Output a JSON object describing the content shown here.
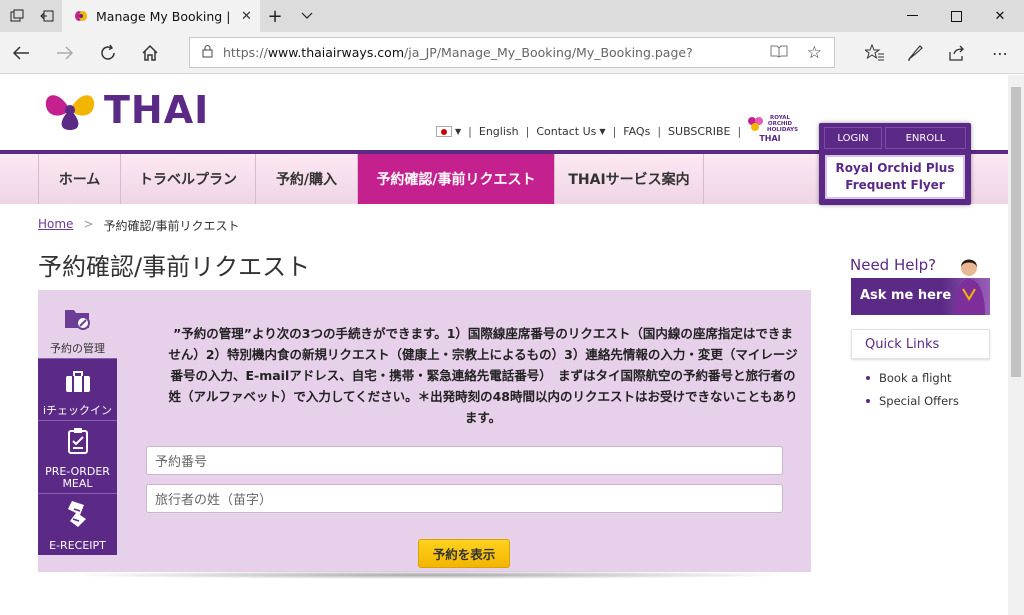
{
  "browser": {
    "tab_title": "Manage My Booking | C",
    "url_scheme": "https://",
    "url_host": "www.thaiairways.com",
    "url_path": "/ja_JP/Manage_My_Booking/My_Booking.page?"
  },
  "header": {
    "logo_text": "THAI",
    "links": [
      "English",
      "Contact Us",
      "FAQs",
      "SUBSCRIBE"
    ],
    "roh_text": "ROYAL ORCHID HOLIDAYS",
    "roh_sub": "THAI"
  },
  "nav": {
    "items": [
      "ホーム",
      "トラベルプラン",
      "予約/購入",
      "予約確認/事前リクエスト",
      "THAIサービス案内"
    ],
    "active_index": 3
  },
  "rop": {
    "login": "LOGIN",
    "enroll": "ENROLL",
    "line1": "Royal Orchid Plus",
    "line2": "Frequent Flyer"
  },
  "breadcrumb": {
    "home": "Home",
    "current": "予約確認/事前リクエスト"
  },
  "page_title": "予約確認/事前リクエスト",
  "side_tabs": [
    "予約の管理",
    "iチェックイン",
    "PRE-ORDER MEAL",
    "E-RECEIPT"
  ],
  "notice": "”予約の管理”より次の3つの手続きができます。1）国際線座席番号のリクエスト（国内線の座席指定はできません）2）特別機内食の新規リクエスト（健康上・宗教上によるもの）3）連絡先情報の入力・変更（マイレージ番号の入力、E-mailアドレス、自宅・携帯・緊急連絡先電話番号）　まずはタイ国際航空の予約番号と旅行者の姓（アルファベット）で入力してください。＊出発時刻の48時間以内のリクエストはお受けできないこともあります。",
  "form": {
    "booking_placeholder": "予約番号",
    "surname_placeholder": "旅行者の姓（苗字）",
    "submit_label": "予約を表示"
  },
  "help": {
    "title": "Need Help?",
    "ask_label": "Ask me here",
    "quick_links_title": "Quick Links",
    "quick_links": [
      "Book a flight",
      "Special Offers"
    ]
  },
  "colors": {
    "brand_purple": "#5b2a86",
    "active_magenta": "#c4218f",
    "panel_lilac": "#e7d0ea",
    "submit_yellow": "#f2b500"
  }
}
